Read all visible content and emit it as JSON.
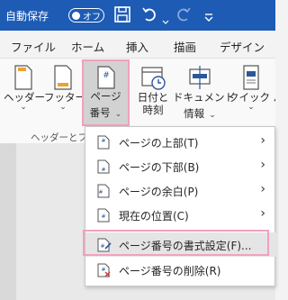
{
  "titlebar": {
    "autosave_label": "自動保存",
    "autosave_state": "オフ"
  },
  "tabs": [
    "ファイル",
    "ホーム",
    "挿入",
    "描画",
    "デザイン"
  ],
  "ribbon": {
    "header": {
      "line1": "ヘッダー",
      "chev": "⌄"
    },
    "footer": {
      "line1": "フッター",
      "chev": "⌄"
    },
    "page_number": {
      "line1": "ページ",
      "line2": "番号",
      "chev": "⌄"
    },
    "datetime": {
      "line1": "日付と",
      "line2": "時刻"
    },
    "docinfo": {
      "line1": "ドキュメント",
      "line2": "情報",
      "chev": "⌄"
    },
    "quickparts": {
      "line1": "クイック パー",
      "chev": "⌄"
    },
    "group_label": "ヘッダーとフッ"
  },
  "menu": {
    "items": [
      {
        "label": "ページの上部(T)",
        "arrow": "›"
      },
      {
        "label": "ページの下部(B)",
        "arrow": "›"
      },
      {
        "label": "ページの余白(P)",
        "arrow": "›"
      },
      {
        "label": "現在の位置(C)",
        "arrow": "›"
      },
      {
        "label": "ページ番号の書式設定(F)..."
      },
      {
        "label": "ページ番号の削除(R)"
      }
    ]
  },
  "colors": {
    "titlebar": "#1d5bb5",
    "highlight_border": "#f1a0c0",
    "accent": "#2b579a"
  }
}
